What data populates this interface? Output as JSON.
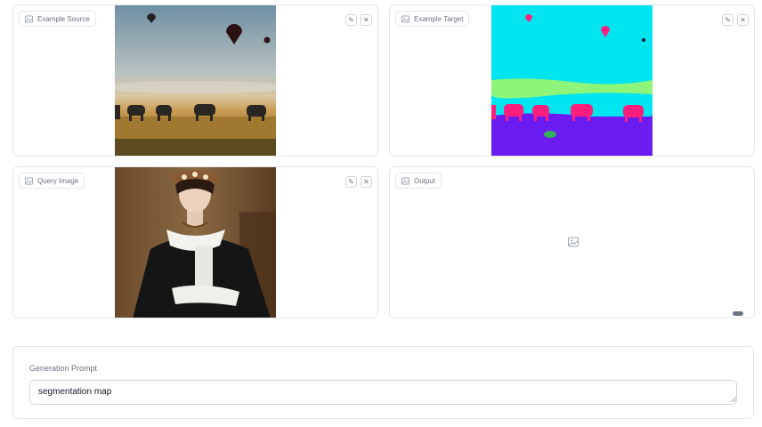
{
  "panels": {
    "example_source": {
      "label": "Example Source",
      "edit_icon": "pencil-icon",
      "clear_icon": "close-icon"
    },
    "example_target": {
      "label": "Example Target",
      "edit_icon": "pencil-icon",
      "clear_icon": "close-icon"
    },
    "query_image": {
      "label": "Query Image",
      "edit_icon": "pencil-icon",
      "clear_icon": "close-icon"
    },
    "output": {
      "label": "Output",
      "placeholder_icon": "image-icon"
    }
  },
  "prompt": {
    "label": "Generation Prompt",
    "value": "segmentation map"
  },
  "colors": {
    "segmentation_sky": "#00e5f0",
    "segmentation_ground": "#6b1cf0",
    "segmentation_elephant": "#ff1e7d",
    "segmentation_horizon": "#8cf57a",
    "border": "#e5e7eb"
  }
}
